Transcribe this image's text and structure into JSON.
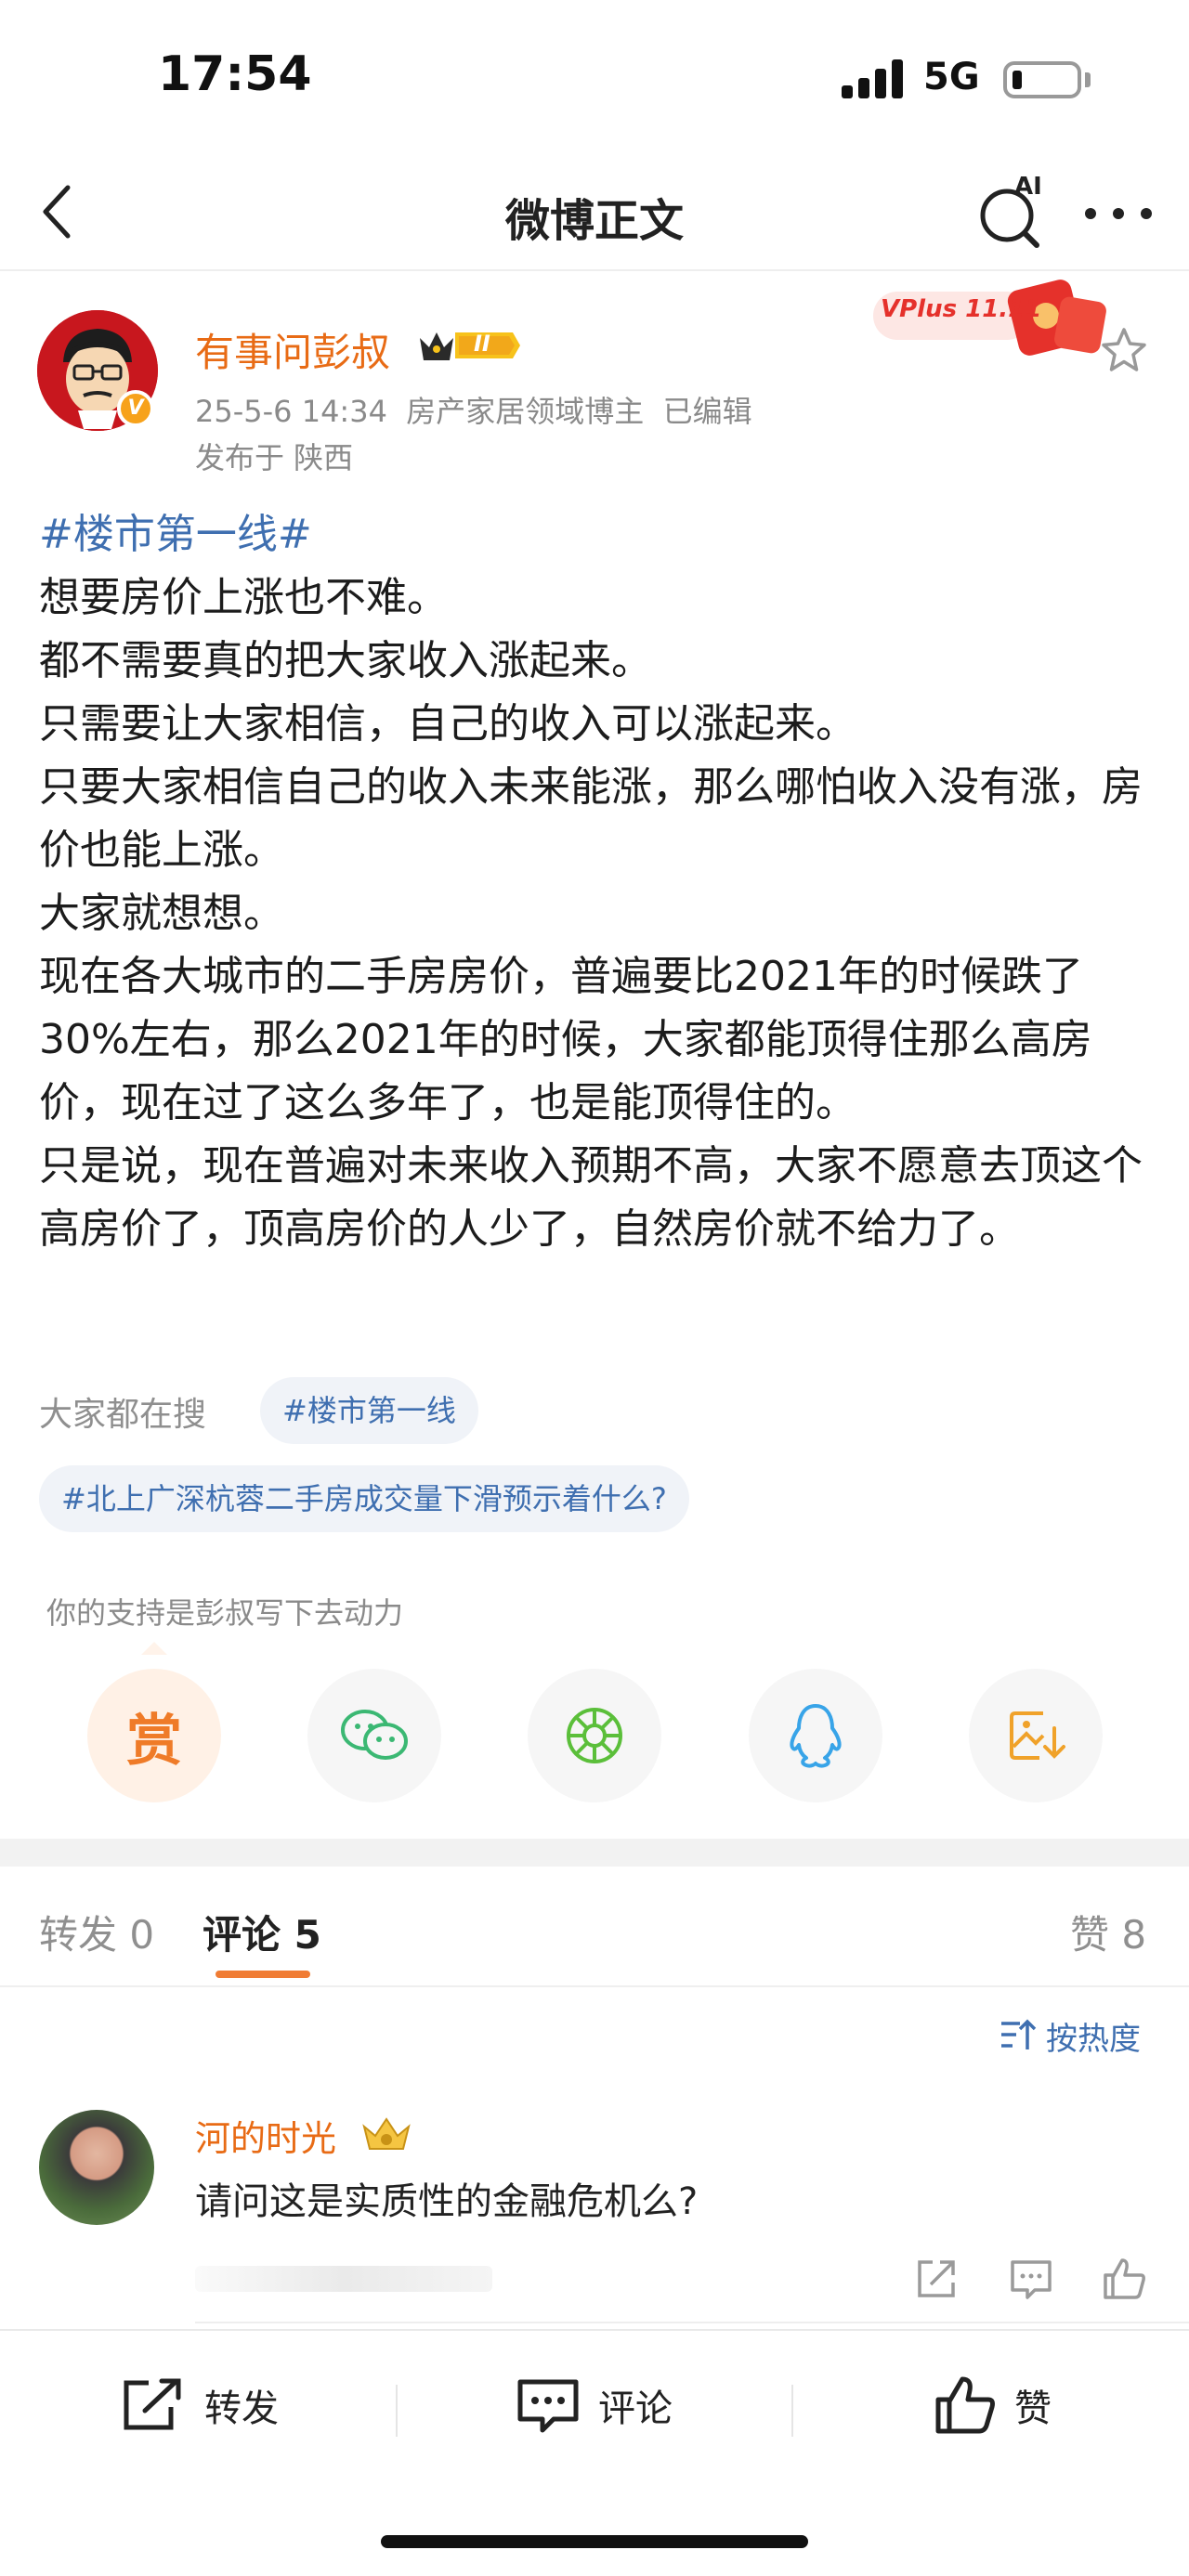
{
  "status_bar": {
    "time": "17:54",
    "network": "5G",
    "battery_level": 0.15
  },
  "nav": {
    "title": "微博正文",
    "ai_label": "AI",
    "back_icon": "chevron-left-icon",
    "more_icon": "more-dots-icon"
  },
  "post": {
    "author": {
      "name": "有事问彭叔",
      "verified_badge": "V",
      "level_badge": "II"
    },
    "meta": "25-5-6 14:34  房产家居领域博主  已编辑",
    "location": "发布于 陕西",
    "promo_banner": "VPlus 11.11",
    "topic": "#楼市第一线#",
    "paragraphs": [
      "想要房价上涨也不难。",
      "都不需要真的把大家收入涨起来。",
      "只需要让大家相信，自己的收入可以涨起来。",
      "只要大家相信自己的收入未来能涨，那么哪怕收入没有涨，房价也能上涨。",
      "大家就想想。",
      "现在各大城市的二手房房价，普遍要比2021年的时候跌了30%左右，那么2021年的时候，大家都能顶得住那么高房价，现在过了这么多年了，也是能顶得住的。",
      "只是说，现在普遍对未来收入预期不高，大家不愿意去顶这个高房价了，顶高房价的人少了，自然房价就不给力了。"
    ]
  },
  "search": {
    "label": "大家都在搜",
    "tags": [
      "#楼市第一线",
      "#北上广深杭蓉二手房成交量下滑预示着什么?"
    ]
  },
  "support": {
    "text": "你的支持是彭叔写下去动力",
    "reward_label": "赏"
  },
  "share_icons": [
    "reward-icon",
    "wechat-icon",
    "moments-icon",
    "qq-icon",
    "save-image-icon"
  ],
  "tabs": {
    "repost": "转发 0",
    "comment": "评论 5",
    "like": "赞 8"
  },
  "sort_label": "按热度",
  "comments": [
    {
      "user": "河的时光",
      "text": "请问这是实质性的金融危机么?"
    }
  ],
  "bottom_bar": {
    "repost": "转发",
    "comment": "评论",
    "like": "赞"
  },
  "colors": {
    "accent_orange": "#e86b15",
    "link_blue": "#3f6fb0",
    "tab_underline": "#f07c34"
  }
}
